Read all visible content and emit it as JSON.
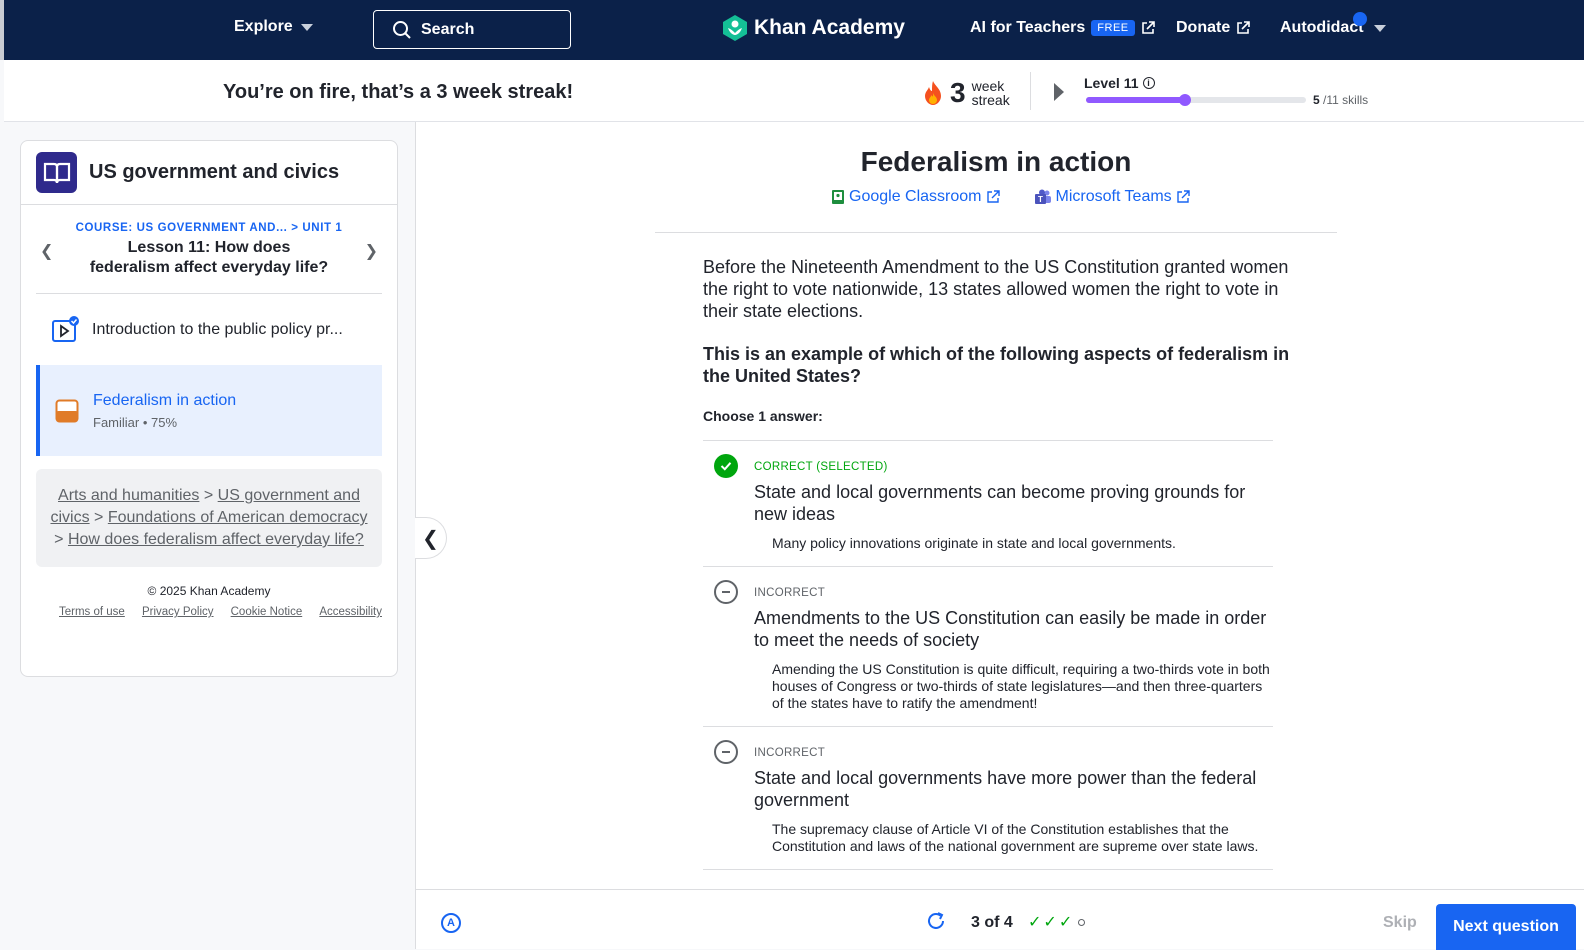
{
  "nav": {
    "explore": "Explore",
    "search_label": "Search",
    "logo": "Khan Academy",
    "ai_teachers": "AI for Teachers",
    "free_badge": "FREE",
    "donate": "Donate",
    "user": "Autodidact"
  },
  "streak": {
    "message": "You’re on fire, that’s a 3 week streak!",
    "count": "3",
    "unit_line1": "week",
    "unit_line2": "streak",
    "level": "Level 11",
    "level_progress": 0.45,
    "skills_done": "5",
    "skills_total": "/11 skills"
  },
  "sidebar": {
    "course_title": "US government and civics",
    "crumb_course": "COURSE: US GOVERNMENT AND...",
    "crumb_sep": ">",
    "crumb_unit": "UNIT 1",
    "lesson_title": "Lesson 11: How does federalism affect everyday life?",
    "items": [
      {
        "label": "Introduction to the public policy pr..."
      },
      {
        "label": "Federalism in action",
        "sub": "Familiar • 75%"
      }
    ],
    "breadcrumb": [
      "Arts and humanities",
      "US government and civics",
      "Foundations of American democracy",
      "How does federalism affect everyday life?"
    ],
    "copyright": "© 2025 Khan Academy",
    "footer": [
      "Terms of use",
      "Privacy Policy",
      "Cookie Notice",
      "Accessibility"
    ]
  },
  "exercise": {
    "title": "Federalism in action",
    "share": [
      "Google Classroom",
      "Microsoft Teams"
    ],
    "question": "Before the Nineteenth Amendment to the US Constitution granted women the right to vote nationwide, 13 states allowed women the right to vote in their state elections.",
    "ask": "This is an example of which of the following aspects of federalism in the United States?",
    "choose": "Choose 1 answer:",
    "choices": [
      {
        "status": "CORRECT (SELECTED)",
        "answer": "State and local governments can become proving grounds for new ideas",
        "rationale": "Many policy innovations originate in state and local governments."
      },
      {
        "status": "INCORRECT",
        "answer": "Amendments to the US Constitution can easily be made in order to meet the needs of society",
        "rationale": "Amending the US Constitution is quite difficult, requiring a two-thirds vote in both houses of Congress or two-thirds of state legislatures—and then three-quarters of the states have to ratify the amendment!"
      },
      {
        "status": "INCORRECT",
        "answer": "State and local governments have more power than the federal government",
        "rationale": "The supremacy clause of Article VI of the Constitution establishes that the Constitution and laws of the national government are supreme over state laws."
      }
    ]
  },
  "footer_bar": {
    "progress": "3 of 4",
    "skip": "Skip",
    "next": "Next question"
  },
  "colors": {
    "nav_bg": "#0b2149",
    "accent": "#1865f2",
    "correct": "#00a60e",
    "level": "#9059ff"
  }
}
